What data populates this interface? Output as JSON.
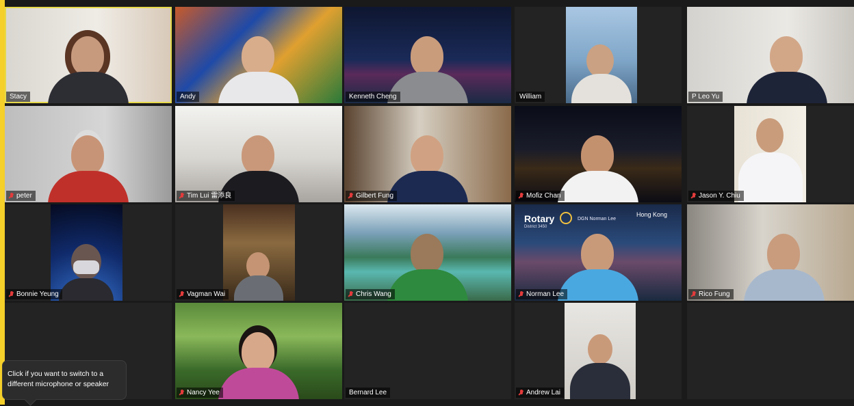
{
  "participants": [
    {
      "name": "Stacy",
      "muted": false
    },
    {
      "name": "Andy",
      "muted": false
    },
    {
      "name": "Kenneth Cheng",
      "muted": false
    },
    {
      "name": "William",
      "muted": false
    },
    {
      "name": "P Leo Yu",
      "muted": false
    },
    {
      "name": "peter",
      "muted": true
    },
    {
      "name": "Tim Lui 雷添良",
      "muted": true
    },
    {
      "name": "Gilbert Fung",
      "muted": true
    },
    {
      "name": "Mofiz Chan",
      "muted": true
    },
    {
      "name": "Jason Y. Chiu",
      "muted": true
    },
    {
      "name": "Bonnie Yeung",
      "muted": true
    },
    {
      "name": "Vagman Wai",
      "muted": true
    },
    {
      "name": "Chris Wang",
      "muted": true
    },
    {
      "name": "Norman Lee",
      "muted": true
    },
    {
      "name": "Rico Fung",
      "muted": true
    },
    {
      "name": "Nancy Yee",
      "muted": true
    },
    {
      "name": "Bernard Lee",
      "muted": false
    },
    {
      "name": "Andrew Lai",
      "muted": true
    }
  ],
  "background_text": {
    "rotary": "Rotary",
    "rotary_district": "District 3450",
    "rotary_dgn": "DGN Norman Lee",
    "rotary_city": "Hong Kong"
  },
  "tooltip": "Click if you want to switch to a different microphone or speaker",
  "colors": {
    "accent": "#f5cf2a",
    "active_speaker": "#e6d94a",
    "muted": "#e23b3b"
  }
}
